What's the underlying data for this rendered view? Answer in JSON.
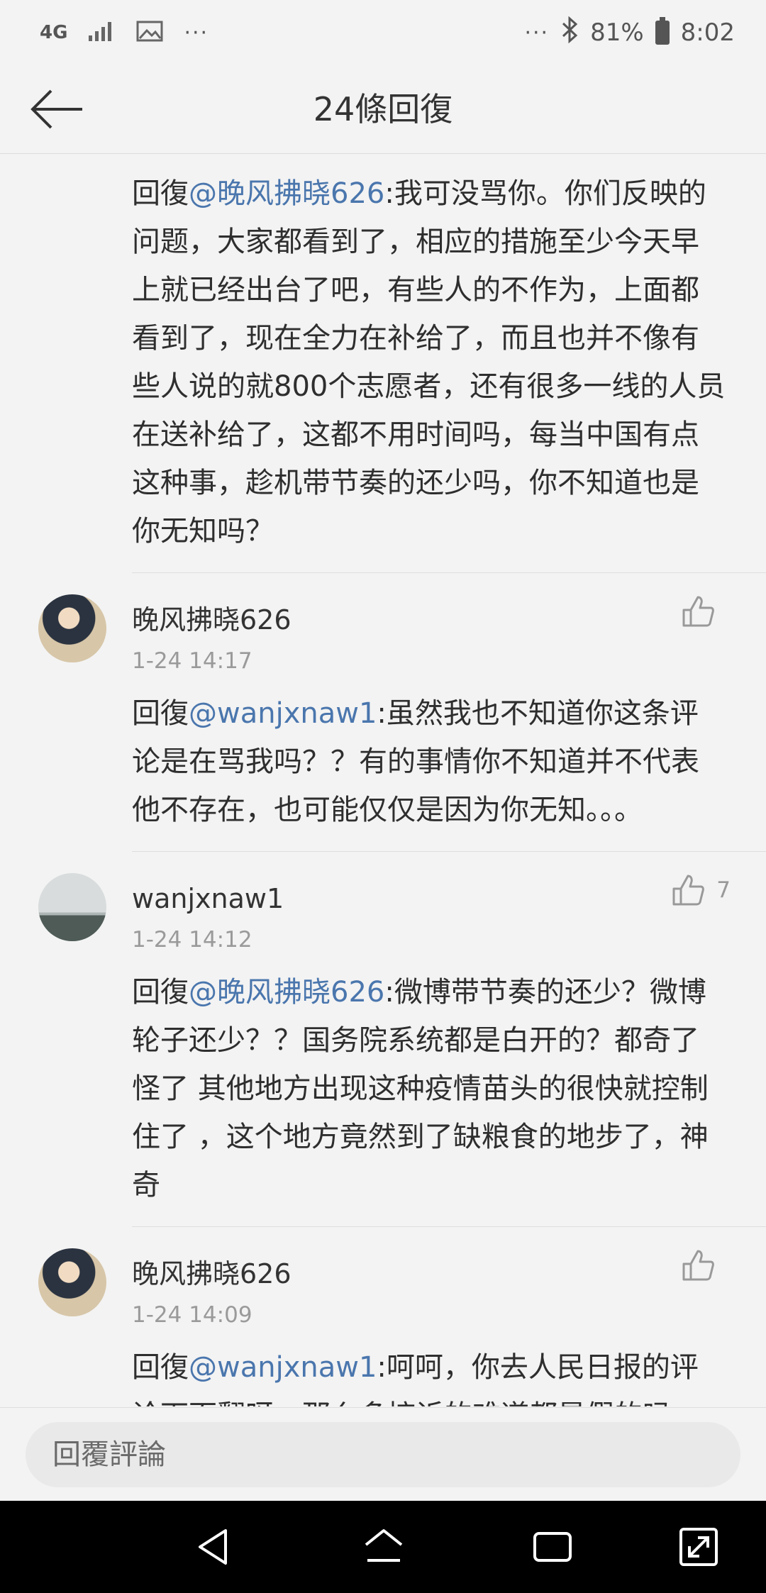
{
  "status_bar": {
    "network": "4G",
    "overflow_left": "···",
    "overflow_right": "···",
    "battery": "81%",
    "time": "8:02",
    "icons": [
      "signal-icon",
      "image-icon",
      "bluetooth-icon",
      "battery-icon"
    ]
  },
  "header": {
    "title": "24條回復",
    "back_icon": "arrow-left-icon"
  },
  "first_reply": {
    "prefix": "回復",
    "mention": "@晚风拂晓626",
    "text": ":我可没骂你。你们反映的问题，大家都看到了，相应的措施至少今天早上就已经出台了吧，有些人的不作为，上面都看到了，现在全力在补给了，而且也并不像有些人说的就800个志愿者，还有很多一线的人员在送补给了，这都不用时间吗，每当中国有点这种事，趁机带节奏的还少吗，你不知道也是你无知吗？"
  },
  "comments": [
    {
      "author": "晚风拂晓626",
      "time": "1-24 14:17",
      "likes": "",
      "prefix": "回復",
      "mention": "@wanjxnaw1",
      "text": ":虽然我也不知道你这条评论是在骂我吗？？有的事情你不知道并不代表他不存在，也可能仅仅是因为你无知。。。"
    },
    {
      "author": "wanjxnaw1",
      "time": "1-24 14:12",
      "likes": "7",
      "prefix": "回復",
      "mention": "@晚风拂晓626",
      "text": ":微博带节奏的还少？微博轮子还少？？国务院系统都是白开的？都奇了怪了  其他地方出现这种疫情苗头的很快就控制住了 ，这个地方竟然到了缺粮食的地步了，神奇"
    },
    {
      "author": "晚风拂晓626",
      "time": "1-24 14:09",
      "likes": "",
      "prefix": "回復",
      "mention": "@wanjxnaw1",
      "text": ":呵呵，你去人民日报的评论下面翻呀，那么多控诉的难道都是假的吗"
    }
  ],
  "input": {
    "placeholder": "回覆評論"
  },
  "nav": {
    "icons": [
      "back-triangle-icon",
      "home-icon",
      "recents-icon",
      "expand-icon"
    ]
  },
  "colors": {
    "mention": "#4a76ad",
    "background": "#f3f3f3",
    "nav_bar": "#000000"
  }
}
